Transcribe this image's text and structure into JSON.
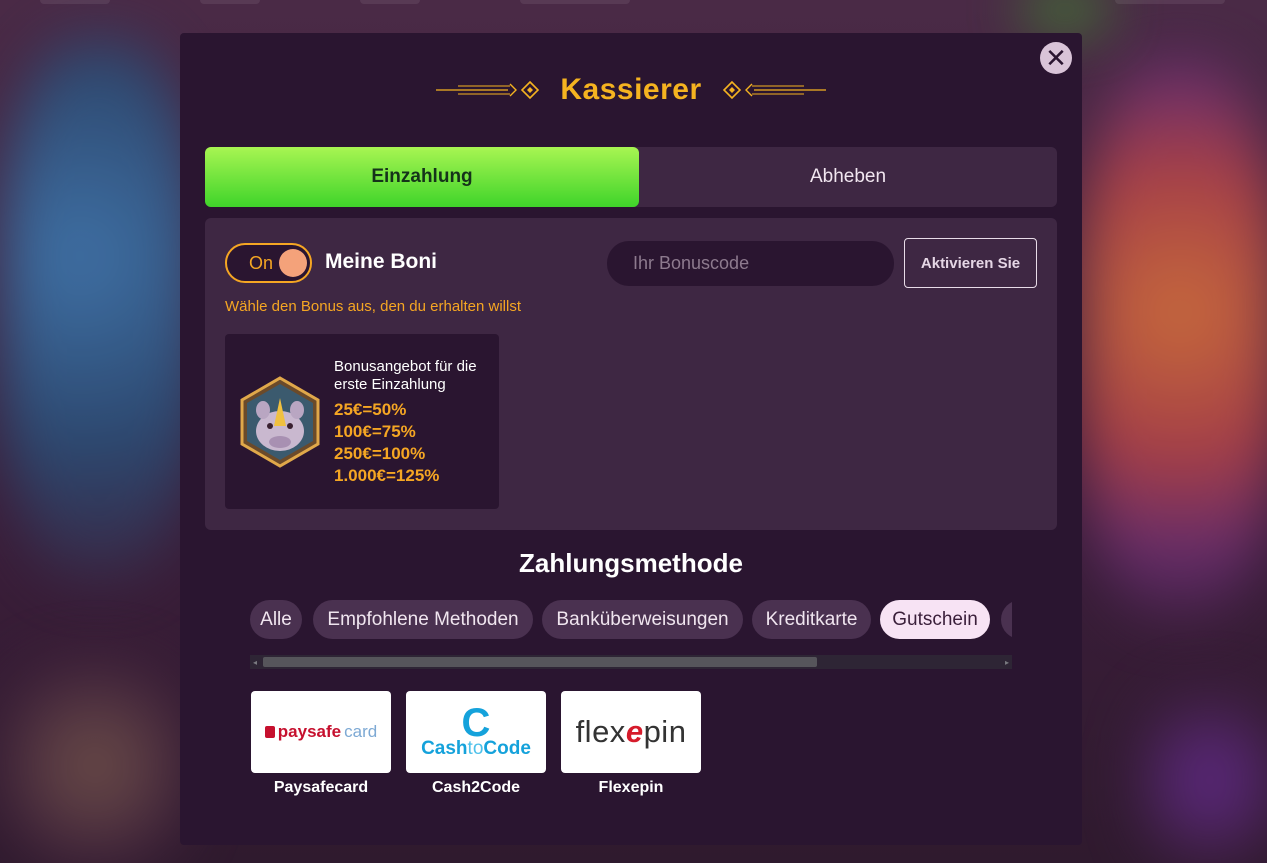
{
  "dialog": {
    "title": "Kassierer",
    "close_label": "✕"
  },
  "tabs": [
    {
      "label": "Einzahlung",
      "active": true
    },
    {
      "label": "Abheben",
      "active": false
    }
  ],
  "bonus": {
    "toggle_label": "On",
    "toggle_on": true,
    "my_bonuses_label": "Meine Boni",
    "code_placeholder": "Ihr Bonuscode",
    "code_value": "",
    "activate_label": "Aktivieren Sie",
    "choose_text": "Wähle den Bonus aus, den du erhalten willst",
    "offer": {
      "title": "Bonusangebot für die erste Einzahlung",
      "tiers": [
        "25€=50%",
        "100€=75%",
        "250€=100%",
        "1.000€=125%"
      ]
    }
  },
  "payment": {
    "title": "Zahlungsmethode",
    "filters": [
      {
        "label": "Alle",
        "active": false
      },
      {
        "label": "Empfohlene Methoden",
        "active": false
      },
      {
        "label": "Banküberweisungen",
        "active": false
      },
      {
        "label": "Kreditkarte",
        "active": false
      },
      {
        "label": "Gutschein",
        "active": true
      }
    ],
    "methods": [
      {
        "name": "Paysafecard",
        "logo_parts": [
          "paysafe",
          "card"
        ]
      },
      {
        "name": "Cash2Code",
        "logo_parts": [
          "C",
          "Cash",
          "to",
          "Code"
        ]
      },
      {
        "name": "Flexepin",
        "logo_parts": [
          "flex",
          "e",
          "pin"
        ]
      }
    ]
  },
  "colors": {
    "accent_gold": "#f5b320",
    "bonus_orange": "#f5a623",
    "active_tab_green": "#3fd42a",
    "panel_bg": "#3e2743",
    "modal_bg": "#2a1530"
  }
}
